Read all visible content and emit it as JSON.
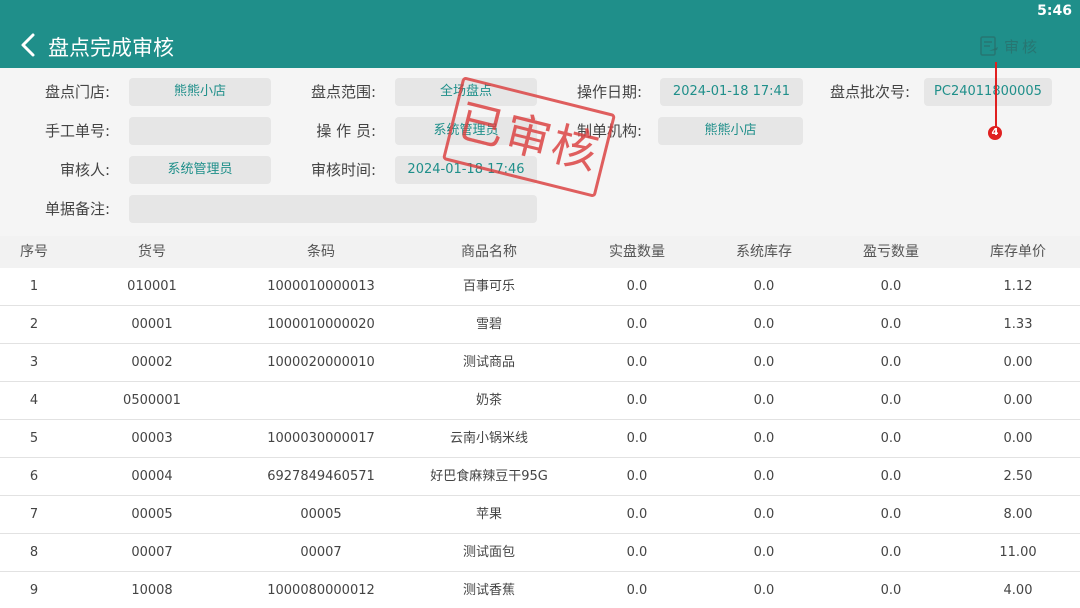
{
  "status_bar": {
    "time": "5:46"
  },
  "header": {
    "title": "盘点完成审核",
    "audit_label": "审核"
  },
  "annotation": {
    "number": "4"
  },
  "stamp": {
    "text": "已审核"
  },
  "form": {
    "store_label": "盘点门店:",
    "store_value": "熊熊小店",
    "range_label": "盘点范围:",
    "range_value": "全场盘点",
    "date_label": "操作日期:",
    "date_value": "2024-01-18 17:41",
    "batch_label": "盘点批次号:",
    "batch_value": "PC24011800005",
    "manual_label": "手工单号:",
    "manual_value": "",
    "operator_label": "操 作 员:",
    "operator_value": "系统管理员",
    "org_label": "制单机构:",
    "org_value": "熊熊小店",
    "reviewer_label": "审核人:",
    "reviewer_value": "系统管理员",
    "review_time_label": "审核时间:",
    "review_time_value": "2024-01-18 17:46",
    "remark_label": "单据备注:",
    "remark_value": ""
  },
  "table": {
    "columns": [
      "序号",
      "货号",
      "条码",
      "商品名称",
      "实盘数量",
      "系统库存",
      "盈亏数量",
      "库存单价"
    ],
    "rows": [
      [
        "1",
        "010001",
        "1000010000013",
        "百事可乐",
        "0.0",
        "0.0",
        "0.0",
        "1.12"
      ],
      [
        "2",
        "00001",
        "1000010000020",
        "雪碧",
        "0.0",
        "0.0",
        "0.0",
        "1.33"
      ],
      [
        "3",
        "00002",
        "1000020000010",
        "测试商品",
        "0.0",
        "0.0",
        "0.0",
        "0.00"
      ],
      [
        "4",
        "0500001",
        "",
        "奶茶",
        "0.0",
        "0.0",
        "0.0",
        "0.00"
      ],
      [
        "5",
        "00003",
        "1000030000017",
        "云南小锅米线",
        "0.0",
        "0.0",
        "0.0",
        "0.00"
      ],
      [
        "6",
        "00004",
        "6927849460571",
        "好巴食麻辣豆干95G",
        "0.0",
        "0.0",
        "0.0",
        "2.50"
      ],
      [
        "7",
        "00005",
        "00005",
        "苹果",
        "0.0",
        "0.0",
        "0.0",
        "8.00"
      ],
      [
        "8",
        "00007",
        "00007",
        "测试面包",
        "0.0",
        "0.0",
        "0.0",
        "11.00"
      ],
      [
        "9",
        "10008",
        "1000080000012",
        "测试香蕉",
        "0.0",
        "0.0",
        "0.0",
        "4.00"
      ]
    ]
  },
  "colors": {
    "primary": "#1f8f8a",
    "stamp": "#db3d3d",
    "annotation": "#e02020"
  }
}
